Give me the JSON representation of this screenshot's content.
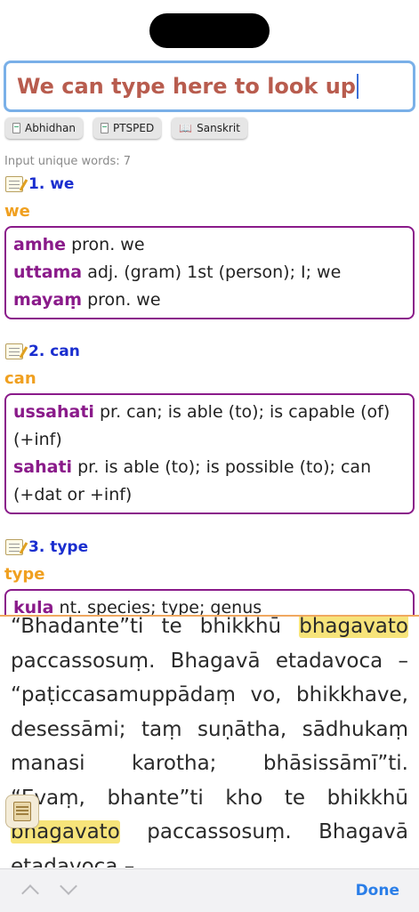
{
  "search": {
    "value": "We can type here to look up"
  },
  "dict_buttons": [
    {
      "label": "Abhidhan",
      "icon": "document-icon"
    },
    {
      "label": "PTSPED",
      "icon": "document-icon"
    },
    {
      "label": "Sanskrit",
      "icon": "book-icon"
    }
  ],
  "meta": {
    "unique_words": "Input unique words: 7"
  },
  "entries": [
    {
      "title": "1. we",
      "word": "we",
      "defs": [
        {
          "term": "amhe",
          "gloss": "pron. we"
        },
        {
          "term": "uttama",
          "gloss": "adj. (gram) 1st (person); I; we"
        },
        {
          "term": "mayaṃ",
          "gloss": "pron. we"
        }
      ]
    },
    {
      "title": "2. can",
      "word": "can",
      "defs": [
        {
          "term": "ussahati",
          "gloss": "pr. can; is able (to); is capable (of) (+inf)"
        },
        {
          "term": "sahati",
          "gloss": "pr. is able (to); is possible (to); can (+dat or +inf)"
        }
      ]
    },
    {
      "title": "3. type",
      "word": "type",
      "defs": [
        {
          "term": "kula",
          "gloss": "nt. species; type; genus"
        }
      ]
    }
  ],
  "reader": {
    "p1_before": "“Bhadante”ti te bhikkhū ",
    "p1_hl": "bhagavato",
    "p1_after": " paccassosuṃ. Bhagavā etadavoca – “paṭiccasamuppādaṃ vo, bhikkhave, desessāmi; taṃ suṇātha, sādhukaṃ manasi karotha; bhāsissāmī”ti. “Evaṃ, bhante”ti kho te bhikkhū ",
    "p2_hl": "bhagavato",
    "p2_after": " paccassosuṃ. Bhagavā etadavoca –"
  },
  "toolbar": {
    "done_label": "Done"
  },
  "colors": {
    "accent": "#2a7ee8",
    "pali": "#8a1a8a",
    "word": "#f0a020",
    "title": "#1a2ecf",
    "highlight": "#f7e47a"
  }
}
